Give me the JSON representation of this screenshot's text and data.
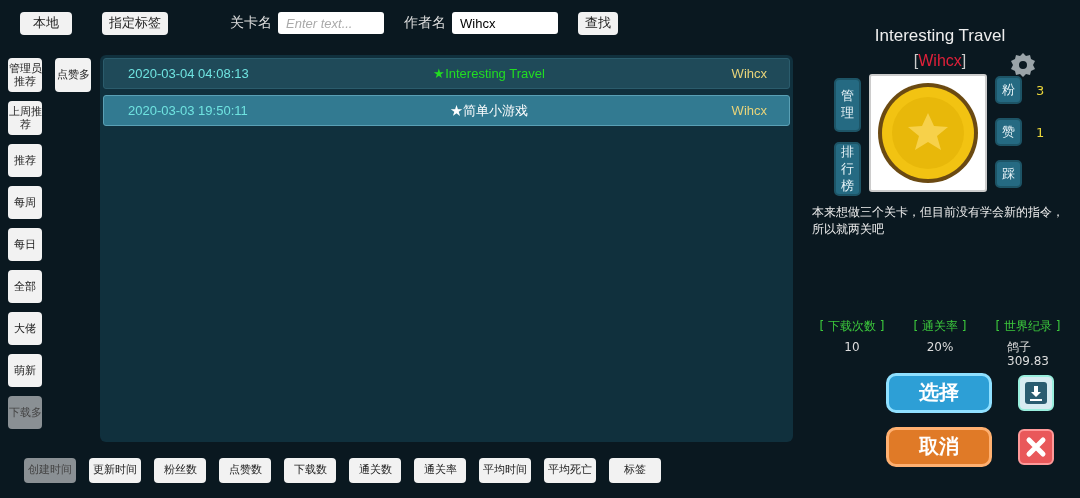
{
  "top_bar": {
    "local_button": "本地",
    "tag_button": "指定标签",
    "level_label": "关卡名",
    "level_field": {
      "placeholder": "Enter text..."
    },
    "author_label": "作者名",
    "author_field": {
      "value": "Wihcx"
    },
    "search_button": "查找"
  },
  "filters": [
    {
      "label": "管理员推荐",
      "selected": false
    },
    {
      "label": "点赞多",
      "selected": false
    },
    {
      "label": "上周推荐",
      "selected": false
    },
    {
      "label": "推荐",
      "selected": false
    },
    {
      "label": "每周",
      "selected": false
    },
    {
      "label": "每日",
      "selected": false
    },
    {
      "label": "全部",
      "selected": false
    },
    {
      "label": "大佬",
      "selected": false
    },
    {
      "label": "萌新",
      "selected": false
    },
    {
      "label": "下载多",
      "selected": true
    }
  ],
  "levels": [
    {
      "time": "2020-03-04 04:08:13",
      "title": "★Interesting Travel",
      "author": "Wihcx",
      "selected": false,
      "color": "#22dd22"
    },
    {
      "time": "2020-03-03 19:50:11",
      "title": "★简单小游戏",
      "author": "Wihcx",
      "selected": true,
      "color": "#ffffff"
    }
  ],
  "sort_buttons": [
    {
      "label": "创建时间",
      "selected": true
    },
    {
      "label": "更新时间",
      "selected": false
    },
    {
      "label": "粉丝数",
      "selected": false
    },
    {
      "label": "点赞数",
      "selected": false
    },
    {
      "label": "下载数",
      "selected": false
    },
    {
      "label": "通关数",
      "selected": false
    },
    {
      "label": "通关率",
      "selected": false
    },
    {
      "label": "平均时间",
      "selected": false
    },
    {
      "label": "平均死亡",
      "selected": false
    },
    {
      "label": "标签",
      "selected": false
    }
  ],
  "detail": {
    "title": "Interesting Travel",
    "author_open": "[",
    "author": "Wihcx",
    "author_close": "]",
    "manage_button": "管理",
    "rank_button": "排行榜",
    "reactions": [
      {
        "label": "粉",
        "count": "3"
      },
      {
        "label": "赞",
        "count": "1"
      },
      {
        "label": "踩"
      }
    ],
    "description": "本来想做三个关卡，但目前没有学会新的指令，所以就两关吧",
    "stats": [
      {
        "label": "[ 下载次数 ]",
        "value": "10"
      },
      {
        "label": "[ 通关率 ]",
        "value": "20%"
      },
      {
        "label": "[ 世界纪录 ]",
        "value": "鸽子",
        "extra": "309.83"
      }
    ],
    "select_button": "选择",
    "cancel_button": "取消"
  }
}
